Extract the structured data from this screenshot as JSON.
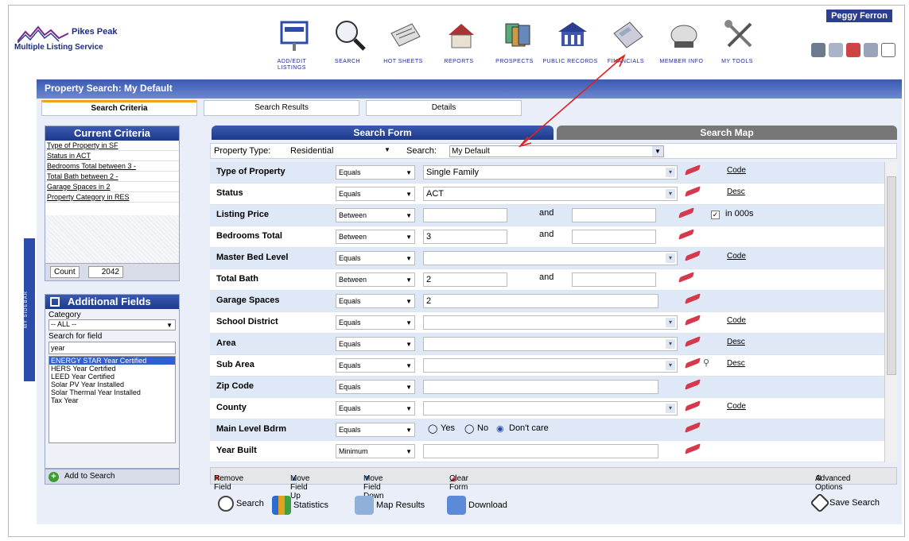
{
  "header": {
    "logo_line1": "Pikes Peak",
    "logo_line2": "Multiple Listing Service",
    "user": "Peggy Ferron",
    "nav": [
      {
        "label": "ADD/EDIT LISTINGS",
        "icon": "listing-sign-icon"
      },
      {
        "label": "SEARCH",
        "icon": "magnifier-icon"
      },
      {
        "label": "HOT SHEETS",
        "icon": "newspaper-icon"
      },
      {
        "label": "REPORTS",
        "icon": "house-report-icon"
      },
      {
        "label": "PROSPECTS",
        "icon": "cards-icon"
      },
      {
        "label": "PUBLIC RECORDS",
        "icon": "building-icon"
      },
      {
        "label": "FINANCIALS",
        "icon": "calculator-icon"
      },
      {
        "label": "MEMBER INFO",
        "icon": "rolodex-icon"
      },
      {
        "label": "MY TOOLS",
        "icon": "tools-icon"
      }
    ]
  },
  "sidebar_toggle": "MY SIDEBAR",
  "page": {
    "title": "Property Search:  My Default",
    "tabs": [
      "Search Criteria",
      "Search Results",
      "Details"
    ]
  },
  "current_criteria": {
    "title": "Current Criteria",
    "items": [
      "Type of Property in SF",
      "Status in ACT",
      "Bedrooms Total between 3 -",
      "Total Bath between 2 -",
      "Garage Spaces in 2",
      "Property Category in RES"
    ],
    "count_label": "Count",
    "count_value": "2042"
  },
  "additional_fields": {
    "title": "Additional Fields",
    "category_label": "Category",
    "category_value": "-- ALL --",
    "search_label": "Search for field",
    "search_value": "year",
    "results": [
      "ENERGY STAR Year Certified",
      "HERS Year Certified",
      "LEED Year Certified",
      "Solar PV Year Installed",
      "Solar Thermal Year Installed",
      "Tax Year"
    ],
    "add_button": "Add to Search"
  },
  "search_form": {
    "tab_form": "Search Form",
    "tab_map": "Search Map",
    "property_type_label": "Property Type:",
    "property_type_value": "Residential",
    "search_label": "Search:",
    "search_value": "My Default",
    "and": "and",
    "in000s": "in 000s",
    "yes": "Yes",
    "no": "No",
    "dontcare": "Don't care",
    "rows": [
      {
        "field": "Type of Property",
        "op": "Equals",
        "value": "Single Family",
        "link": "Code"
      },
      {
        "field": "Status",
        "op": "Equals",
        "value": "ACT",
        "link": "Desc"
      },
      {
        "field": "Listing Price",
        "op": "Between",
        "value": "",
        "value2": ""
      },
      {
        "field": "Bedrooms Total",
        "op": "Between",
        "value": "3",
        "value2": ""
      },
      {
        "field": "Master Bed Level",
        "op": "Equals",
        "value": "",
        "link": "Code"
      },
      {
        "field": "Total Bath",
        "op": "Between",
        "value": "2",
        "value2": ""
      },
      {
        "field": "Garage Spaces",
        "op": "Equals",
        "value": "2"
      },
      {
        "field": "School District",
        "op": "Equals",
        "value": "",
        "link": "Code"
      },
      {
        "field": "Area",
        "op": "Equals",
        "value": "",
        "link": "Desc"
      },
      {
        "field": "Sub Area",
        "op": "Equals",
        "value": "",
        "link": "Desc"
      },
      {
        "field": "Zip Code",
        "op": "Equals",
        "value": ""
      },
      {
        "field": "County",
        "op": "Equals",
        "value": "",
        "link": "Code"
      },
      {
        "field": "Main Level Bdrm",
        "op": "Equals",
        "value": ""
      },
      {
        "field": "Year Built",
        "op": "Minimum",
        "value": ""
      }
    ],
    "actions": [
      "Remove Field",
      "Move Field Up",
      "Move Field Down",
      "Clear Form",
      "Advanced Options"
    ],
    "bottom": [
      "Search",
      "Statistics",
      "Map Results",
      "Download",
      "Save Search"
    ]
  },
  "colors": {
    "primary": "#2b4ca8",
    "accent": "#f2a21c",
    "annotation": "#e02020"
  }
}
